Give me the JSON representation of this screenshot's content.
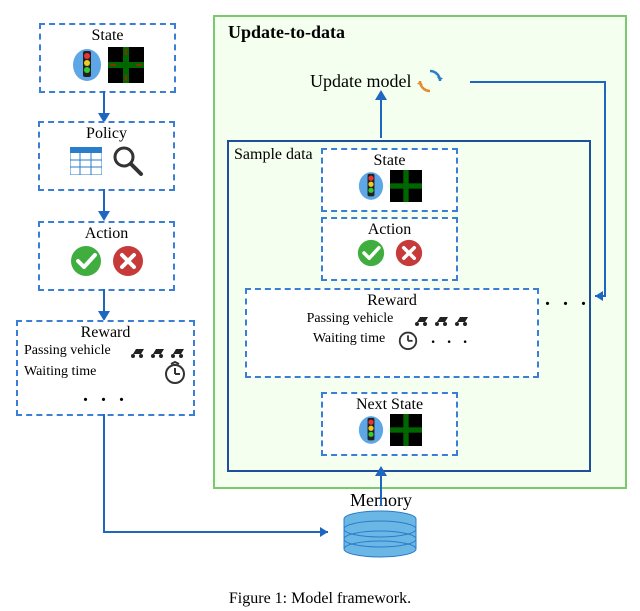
{
  "diagram": {
    "title": "Update-to-data",
    "update_model_label": "Update model",
    "sample_data_label": "Sample data",
    "memory_label": "Memory"
  },
  "left_pipeline": {
    "state": {
      "label": "State"
    },
    "policy": {
      "label": "Policy"
    },
    "action": {
      "label": "Action"
    },
    "reward": {
      "label": "Reward",
      "line1": "Passing vehicle",
      "line2": "Waiting time"
    },
    "ellipsis": ". . ."
  },
  "inner_sample": {
    "state": {
      "label": "State"
    },
    "action": {
      "label": "Action"
    },
    "reward": {
      "label": "Reward",
      "line1": "Passing vehicle",
      "line2": "Waiting time"
    },
    "next_state": {
      "label": "Next State"
    },
    "ellipsis": ". . ."
  },
  "caption": "Figure 1: Model framework."
}
